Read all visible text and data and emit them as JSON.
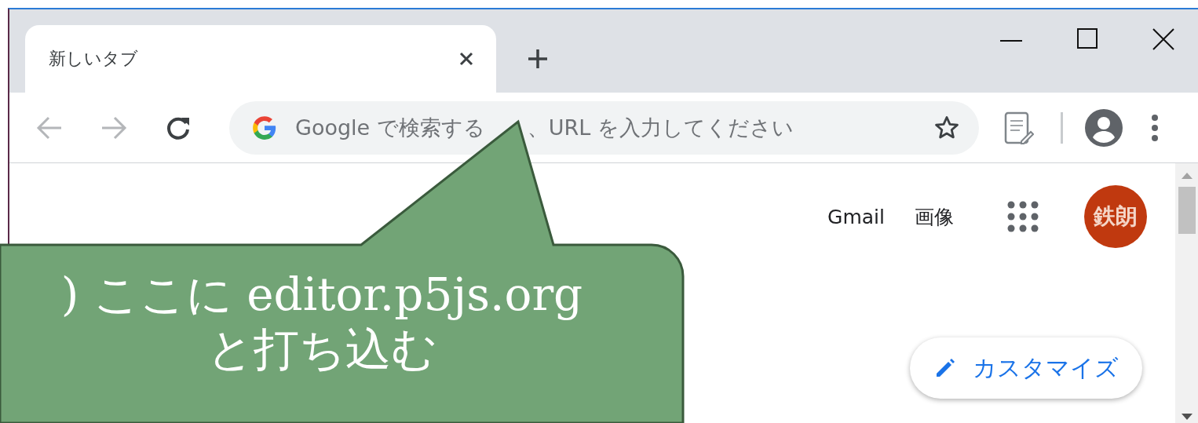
{
  "tabs": [
    {
      "label": "新しいタブ",
      "selected": true
    }
  ],
  "omnibox": {
    "placeholder_parts": [
      "Google で検索する",
      "、URL を入力してください"
    ]
  },
  "header_links": [
    "Gmail",
    "画像"
  ],
  "avatar": {
    "initials": "鉄朗"
  },
  "customize_button": {
    "label": "カスタマイズ"
  },
  "callout": {
    "lines": [
      ") ここに editor.p5js.org",
      "と打ち込む"
    ]
  }
}
